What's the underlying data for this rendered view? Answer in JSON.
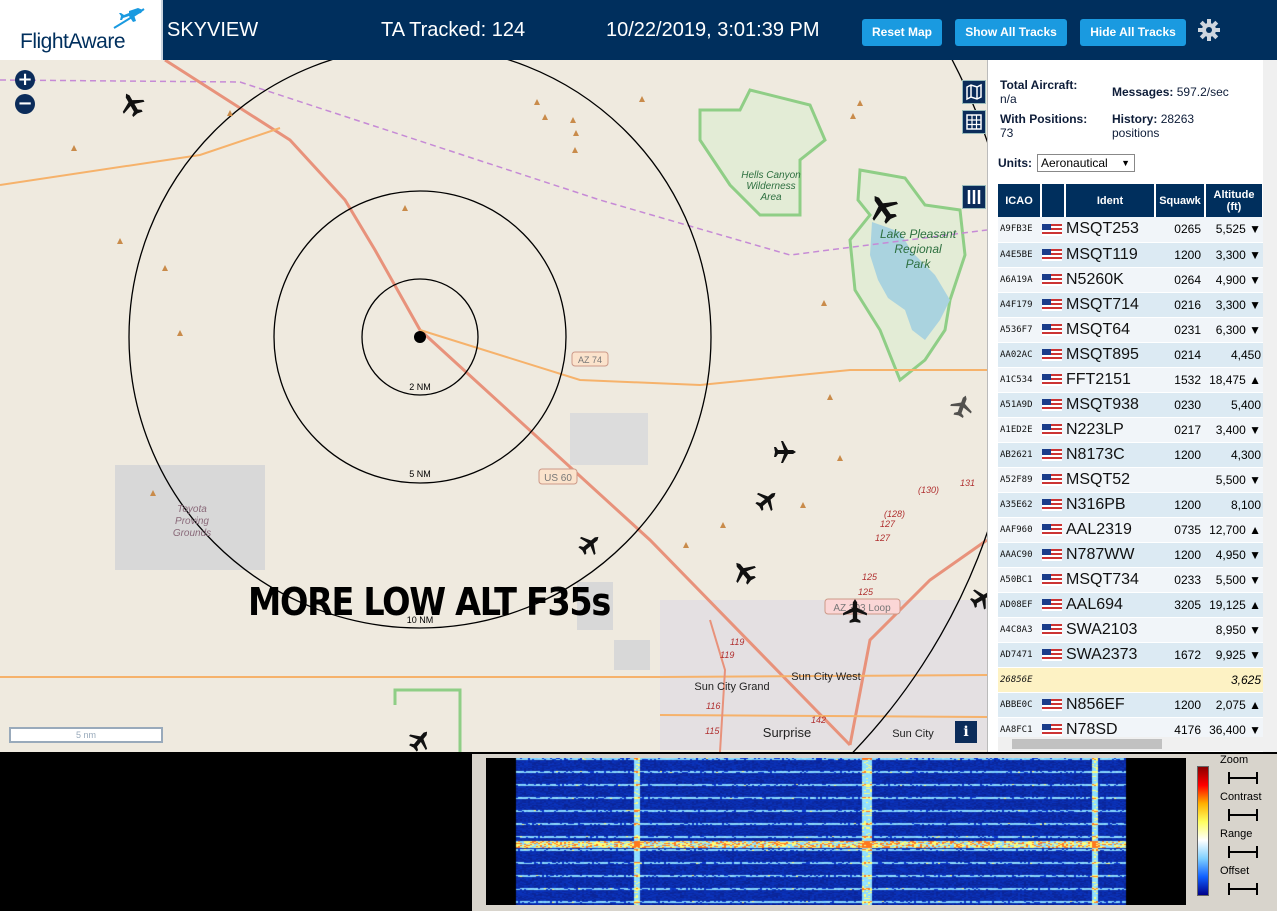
{
  "header": {
    "logo_text": "FlightAware",
    "app_name": "SKYVIEW",
    "tracked_label": "TA Tracked: 124",
    "datetime": "10/22/2019, 3:01:39 PM",
    "buttons": {
      "reset_map": "Reset Map",
      "show_all": "Show All Tracks",
      "hide_all": "Hide All Tracks"
    },
    "colors": {
      "bar": "#002f5d",
      "button": "#1a9ae0"
    }
  },
  "map": {
    "zoom_in": "+",
    "zoom_out": "−",
    "overlay_text": "MORE LOW ALT F35s",
    "scale_label": "5 nm",
    "info_label": "i",
    "range_rings": [
      "2 NM",
      "5 NM",
      "10 NM"
    ],
    "road_labels": [
      "AZ 74",
      "US 60",
      "AZ 303 Loop"
    ],
    "place_labels": [
      "Hells Canyon",
      "Wilderness",
      "Area",
      "Lake Pleasant",
      "Regional",
      "Park",
      "Toyota",
      "Proving",
      "Grounds",
      "Sun City Grand",
      "Sun City West",
      "Surprise",
      "Sun City"
    ],
    "route_numbers": [
      "(130)",
      "131",
      "(128)",
      "127",
      "127",
      "125",
      "125",
      "119",
      "119",
      "116",
      "115",
      "142"
    ]
  },
  "stats": {
    "total_label": "Total Aircraft:",
    "total_value": "n/a",
    "positions_label": "With Positions:",
    "positions_value": "73",
    "messages_label": "Messages:",
    "messages_value": "597.2/sec",
    "history_label": "History:",
    "history_value": "28263",
    "history_unit": "positions"
  },
  "units": {
    "label": "Units:",
    "selected": "Aeronautical"
  },
  "table": {
    "headers": {
      "icao": "ICAO",
      "ident": "Ident",
      "squawk": "Squawk",
      "altitude": "Altitude",
      "altitude_unit": "(ft)"
    },
    "rows": [
      {
        "icao": "A9FB3E",
        "ident": "MSQT253",
        "squawk": "0265",
        "alt": "5,525 ▼"
      },
      {
        "icao": "A4E5BE",
        "ident": "MSQT119",
        "squawk": "1200",
        "alt": "3,300 ▼"
      },
      {
        "icao": "A6A19A",
        "ident": "N5260K",
        "squawk": "0264",
        "alt": "4,900 ▼"
      },
      {
        "icao": "A4F179",
        "ident": "MSQT714",
        "squawk": "0216",
        "alt": "3,300 ▼"
      },
      {
        "icao": "A536F7",
        "ident": "MSQT64",
        "squawk": "0231",
        "alt": "6,300 ▼"
      },
      {
        "icao": "AA02AC",
        "ident": "MSQT895",
        "squawk": "0214",
        "alt": "4,450"
      },
      {
        "icao": "A1C534",
        "ident": "FFT2151",
        "squawk": "1532",
        "alt": "18,475 ▲"
      },
      {
        "icao": "A51A9D",
        "ident": "MSQT938",
        "squawk": "0230",
        "alt": "5,400"
      },
      {
        "icao": "A1ED2E",
        "ident": "N223LP",
        "squawk": "0217",
        "alt": "3,400 ▼"
      },
      {
        "icao": "AB2621",
        "ident": "N8173C",
        "squawk": "1200",
        "alt": "4,300"
      },
      {
        "icao": "A52F89",
        "ident": "MSQT52",
        "squawk": "",
        "alt": "5,500 ▼"
      },
      {
        "icao": "A35E62",
        "ident": "N316PB",
        "squawk": "1200",
        "alt": "8,100"
      },
      {
        "icao": "AAF960",
        "ident": "AAL2319",
        "squawk": "0735",
        "alt": "12,700 ▲"
      },
      {
        "icao": "AAAC90",
        "ident": "N787WW",
        "squawk": "1200",
        "alt": "4,950 ▼"
      },
      {
        "icao": "A50BC1",
        "ident": "MSQT734",
        "squawk": "0233",
        "alt": "5,500 ▼"
      },
      {
        "icao": "AD08EF",
        "ident": "AAL694",
        "squawk": "3205",
        "alt": "19,125 ▲"
      },
      {
        "icao": "A4C8A3",
        "ident": "SWA2103",
        "squawk": "",
        "alt": "8,950 ▼"
      },
      {
        "icao": "AD7471",
        "ident": "SWA2373",
        "squawk": "1672",
        "alt": "9,925 ▼"
      },
      {
        "icao": "26856E",
        "ident": "",
        "squawk": "",
        "alt": "3,625"
      },
      {
        "icao": "ABBE0C",
        "ident": "N856EF",
        "squawk": "1200",
        "alt": "2,075 ▲"
      },
      {
        "icao": "AA8FC1",
        "ident": "N78SD",
        "squawk": "4176",
        "alt": "36,400 ▼"
      }
    ]
  },
  "spectrum": {
    "controls": [
      "Zoom",
      "Contrast",
      "Range",
      "Offset"
    ]
  }
}
